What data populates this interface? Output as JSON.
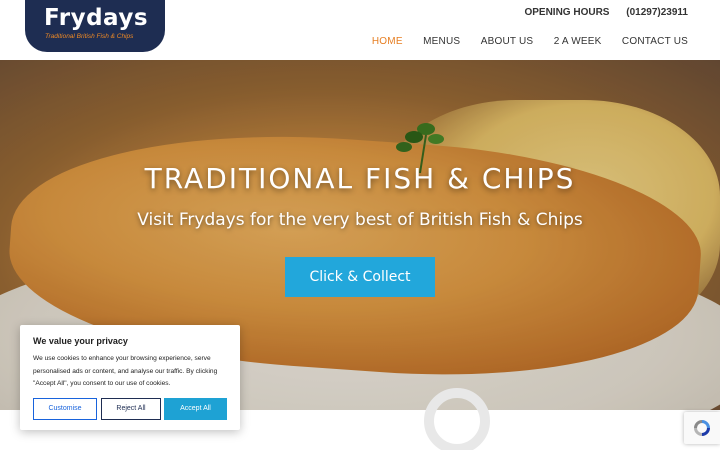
{
  "header": {
    "logo_text": "Frydays",
    "logo_tagline": "Traditional British Fish & Chips",
    "opening_hours_label": "OPENING HOURS",
    "phone": "(01297)23911"
  },
  "nav": {
    "items": [
      {
        "label": "HOME",
        "active": true
      },
      {
        "label": "MENUS",
        "active": false
      },
      {
        "label": "ABOUT US",
        "active": false
      },
      {
        "label": "2 A WEEK",
        "active": false
      },
      {
        "label": "CONTACT US",
        "active": false
      }
    ]
  },
  "hero": {
    "title": "TRADITIONAL FISH & CHIPS",
    "subtitle": "Visit Frydays for the very best of British Fish & Chips",
    "cta_label": "Click & Collect"
  },
  "cookie_banner": {
    "title": "We value your privacy",
    "text": "We use cookies to enhance your browsing experience, serve personalised ads or content, and analyse our traffic. By clicking \"Accept All\", you consent to our use of cookies.",
    "customise_label": "Customise",
    "reject_label": "Reject All",
    "accept_label": "Accept All"
  },
  "icons": {
    "recaptcha": "recaptcha-icon",
    "loading_ring": "loading-ring-icon"
  },
  "colors": {
    "brand_navy": "#1e2d52",
    "accent_orange": "#e67e22",
    "cta_blue": "#22a7db",
    "cookie_blue": "#1863dc"
  }
}
